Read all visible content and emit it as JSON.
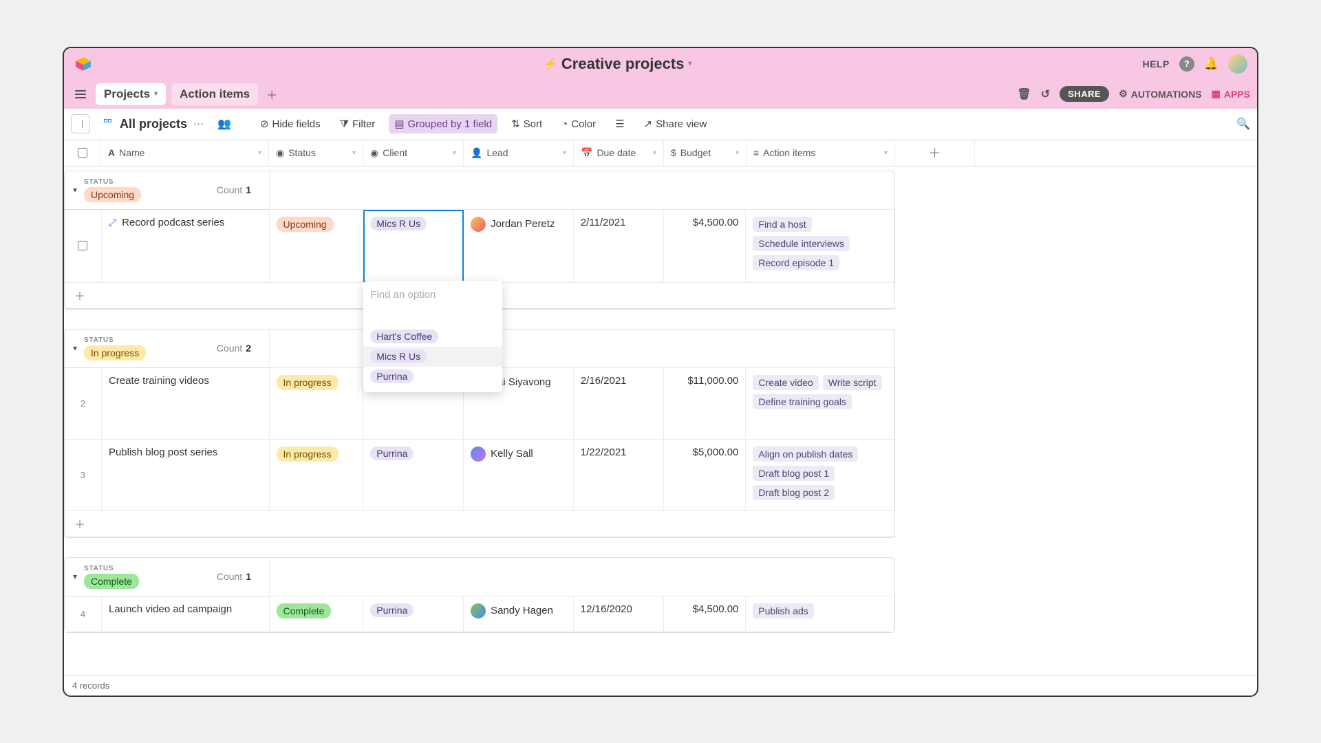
{
  "titlebar": {
    "base_name": "Creative projects",
    "help": "HELP",
    "automations": "AUTOMATIONS",
    "apps": "APPS",
    "share": "SHARE"
  },
  "tabs": {
    "primary": "Projects",
    "secondary": "Action items"
  },
  "toolbar": {
    "view_name": "All projects",
    "hide_fields": "Hide fields",
    "filter": "Filter",
    "grouped": "Grouped by 1 field",
    "sort": "Sort",
    "color": "Color",
    "share_view": "Share view"
  },
  "columns": {
    "name": "Name",
    "status": "Status",
    "client": "Client",
    "lead": "Lead",
    "due": "Due date",
    "budget": "Budget",
    "actions": "Action items"
  },
  "group_caption": "STATUS",
  "count_label": "Count",
  "groups": [
    {
      "status": "Upcoming",
      "pill_class": "pill-upcoming",
      "count": "1"
    },
    {
      "status": "In progress",
      "pill_class": "pill-inprogress",
      "count": "2"
    },
    {
      "status": "Complete",
      "pill_class": "pill-complete",
      "count": "1"
    }
  ],
  "rows": {
    "r1": {
      "name": "Record podcast series",
      "status": "Upcoming",
      "client": "Mics R Us",
      "lead": "Jordan Peretz",
      "due": "2/11/2021",
      "budget": "$4,500.00",
      "actions": [
        "Find a host",
        "Schedule interviews",
        "Record episode 1"
      ]
    },
    "r2": {
      "num": "2",
      "name": "Create training videos",
      "status": "In progress",
      "client": "Hart's Coffee",
      "lead": "Kai Siyavong",
      "due": "2/16/2021",
      "budget": "$11,000.00",
      "actions": [
        "Create video",
        "Write script",
        "Define training goals"
      ]
    },
    "r3": {
      "num": "3",
      "name": "Publish blog post series",
      "status": "In progress",
      "client": "Purrina",
      "lead": "Kelly Sall",
      "due": "1/22/2021",
      "budget": "$5,000.00",
      "actions": [
        "Align on publish dates",
        "Draft blog post 1",
        "Draft blog post 2"
      ]
    },
    "r4": {
      "num": "4",
      "name": "Launch video ad campaign",
      "status": "Complete",
      "client": "Purrina",
      "lead": "Sandy Hagen",
      "due": "12/16/2020",
      "budget": "$4,500.00",
      "actions": [
        "Publish ads"
      ]
    }
  },
  "dropdown": {
    "placeholder": "Find an option",
    "options": [
      "Hart's Coffee",
      "Mics R Us",
      "Purrina"
    ]
  },
  "footer": {
    "records": "4 records"
  }
}
